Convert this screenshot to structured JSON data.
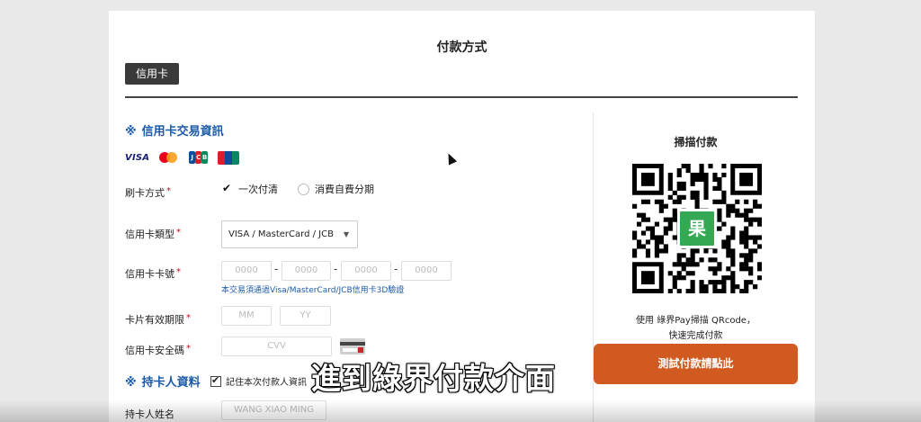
{
  "page_title": "付款方式",
  "tab_label": "信用卡",
  "section_credit": {
    "mark": "※",
    "title": "信用卡交易資訊"
  },
  "card_logos": [
    "VISA",
    "MasterCard",
    "JCB",
    "UnionPay"
  ],
  "payment_method": {
    "label": "刷卡方式",
    "required": "*",
    "options": [
      {
        "label": "一次付清",
        "checked": true
      },
      {
        "label": "消費自費分期",
        "checked": false
      }
    ]
  },
  "card_type": {
    "label": "信用卡類型",
    "required": "*",
    "value": "VISA / MasterCard / JCB",
    "caret": "▼"
  },
  "card_number": {
    "label": "信用卡卡號",
    "required": "*",
    "placeholders": [
      "0000",
      "0000",
      "0000",
      "0000"
    ],
    "separator": "-",
    "hint": "本交易須通過Visa/MasterCard/JCB信用卡3D驗證"
  },
  "expiry": {
    "label": "卡片有效期限",
    "required": "*",
    "month_placeholder": "MM",
    "year_placeholder": "YY"
  },
  "cvv": {
    "label": "信用卡安全碼",
    "required": "*",
    "placeholder": "CVV"
  },
  "section_holder": {
    "mark": "※",
    "title": "持卡人資料"
  },
  "remember": {
    "label": "記住本次付款人資訊",
    "checked": true
  },
  "holder_name": {
    "label": "持卡人姓名",
    "placeholder": "WANG XIAO MING"
  },
  "qr": {
    "title": "掃描付款",
    "logo_glyph": "果",
    "desc_line1": "使用 綠界Pay掃描 QRcode，",
    "desc_line2": "快速完成付款"
  },
  "test_button": "測試付款請點此",
  "subtitle": "進到綠界付款介面",
  "colors": {
    "accent_blue": "#1c5aa7",
    "button_orange": "#d15a21",
    "required_red": "#d0021b",
    "qr_green": "#35a853"
  }
}
